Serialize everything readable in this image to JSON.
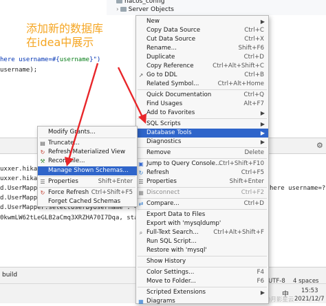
{
  "annotation": {
    "line1": "添加新的数据库",
    "line2": "在idea中展示"
  },
  "tree": {
    "item1": "nacos_config",
    "item2": "Server Objects"
  },
  "code": {
    "line1_prefix": "here username=#{",
    "line1_var": "username",
    "line1_suffix": "}\")",
    "line2": "username);"
  },
  "log": {
    "lines": [
      "uxxer.hikar",
      "uxxer.hikar",
      "d.UserMapper",
      "d.UserMapper",
      "d.UserMapper.selectUserByUsername  : <==",
      "0kwmLW62tLeGLB2aCmq3XRZHA70I7Dqa, statu"
    ],
    "right_text": "here username=?"
  },
  "build_label": "build",
  "status": {
    "encoding": "UTF-8",
    "indent": "4 spaces",
    "ime": "中",
    "time": "15:53",
    "date": "2021/12/7",
    "watermark": "CSDN @月影星云"
  },
  "main_menu": {
    "items": [
      {
        "label": "New",
        "shortcut": "",
        "submenu": true
      },
      {
        "label": "Copy Data Source",
        "shortcut": "Ctrl+C"
      },
      {
        "label": "Cut Data Source",
        "shortcut": "Ctrl+X"
      },
      {
        "label": "Rename...",
        "shortcut": "Shift+F6"
      },
      {
        "label": "Duplicate",
        "shortcut": "Ctrl+D"
      },
      {
        "label": "Copy Reference",
        "shortcut": "Ctrl+Alt+Shift+C"
      },
      {
        "label": "Go to DDL",
        "shortcut": "Ctrl+B"
      },
      {
        "label": "Related Symbol...",
        "shortcut": "Ctrl+Alt+Home"
      },
      {
        "label": "Quick Documentation",
        "shortcut": "Ctrl+Q"
      },
      {
        "label": "Find Usages",
        "shortcut": "Alt+F7"
      },
      {
        "label": "Add to Favorites",
        "shortcut": ""
      },
      {
        "label": "SQL Scripts",
        "shortcut": ""
      },
      {
        "label": "Database Tools",
        "shortcut": ""
      },
      {
        "label": "Diagnostics",
        "shortcut": ""
      },
      {
        "label": "Remove",
        "shortcut": "Delete"
      },
      {
        "label": "Jump to Query Console...",
        "shortcut": "Ctrl+Shift+F10"
      },
      {
        "label": "Refresh",
        "shortcut": "Ctrl+F5"
      },
      {
        "label": "Properties",
        "shortcut": "Shift+Enter"
      },
      {
        "label": "Disconnect",
        "shortcut": "Ctrl+F2"
      },
      {
        "label": "Compare...",
        "shortcut": "Ctrl+D"
      },
      {
        "label": "Export Data to Files",
        "shortcut": ""
      },
      {
        "label": "Export with 'mysqldump'",
        "shortcut": ""
      },
      {
        "label": "Full-Text Search...",
        "shortcut": "Ctrl+Alt+Shift+F"
      },
      {
        "label": "Run SQL Script...",
        "shortcut": ""
      },
      {
        "label": "Restore with 'mysql'",
        "shortcut": ""
      },
      {
        "label": "Show History",
        "shortcut": ""
      },
      {
        "label": "Color Settings...",
        "shortcut": "F4"
      },
      {
        "label": "Move to Folder...",
        "shortcut": "F6"
      },
      {
        "label": "Scripted Extensions",
        "shortcut": ""
      },
      {
        "label": "Diagrams",
        "shortcut": ""
      }
    ]
  },
  "sub_menu": {
    "items": [
      {
        "label": "Modify Grants...",
        "shortcut": ""
      },
      {
        "label": "Truncate...",
        "shortcut": ""
      },
      {
        "label": "Refresh Materialized View",
        "shortcut": ""
      },
      {
        "label": "Recompile...",
        "shortcut": ""
      },
      {
        "label": "Manage Shown Schemas...",
        "shortcut": ""
      },
      {
        "label": "Properties",
        "shortcut": "Shift+Enter"
      },
      {
        "label": "Force Refresh",
        "shortcut": "Ctrl+Shift+F5"
      },
      {
        "label": "Forget Cached Schemas",
        "shortcut": ""
      }
    ]
  },
  "colors": {
    "highlight": "#2f65ca",
    "annotation": "#f5a623",
    "arrow": "#e8262a"
  }
}
